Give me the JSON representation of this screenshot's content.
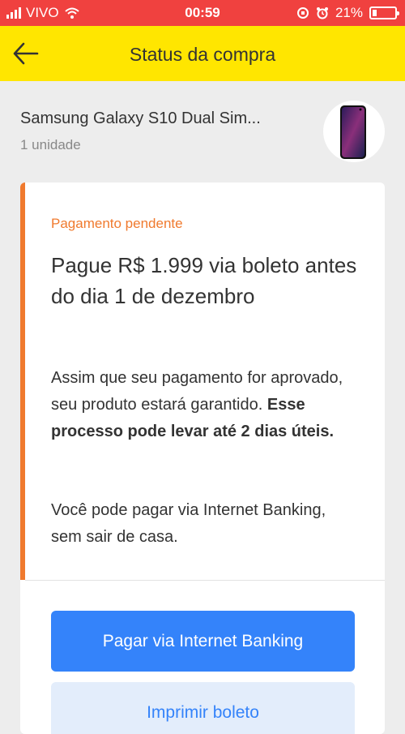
{
  "status_bar": {
    "carrier": "VIVO",
    "time": "00:59",
    "battery": "21%",
    "battery_level": 0.21
  },
  "header": {
    "title": "Status da compra",
    "back_icon": "arrow-left-icon"
  },
  "product": {
    "name": "Samsung Galaxy S10 Dual Sim...",
    "quantity": "1 unidade"
  },
  "payment": {
    "status": "Pagamento pendente",
    "headline": "Pague R$ 1.999 via boleto antes do dia 1 de dezembro",
    "description_regular": "Assim que seu pagamento for aprovado, seu produto estará garantido. ",
    "description_bold": "Esse processo pode levar até 2 dias úteis.",
    "note": "Você pode pagar via Internet Banking, sem sair de casa.",
    "accent_color": "#f07a2e"
  },
  "actions": {
    "primary_label": "Pagar via Internet Banking",
    "secondary_label": "Imprimir boleto",
    "primary_color": "#3483fa"
  }
}
